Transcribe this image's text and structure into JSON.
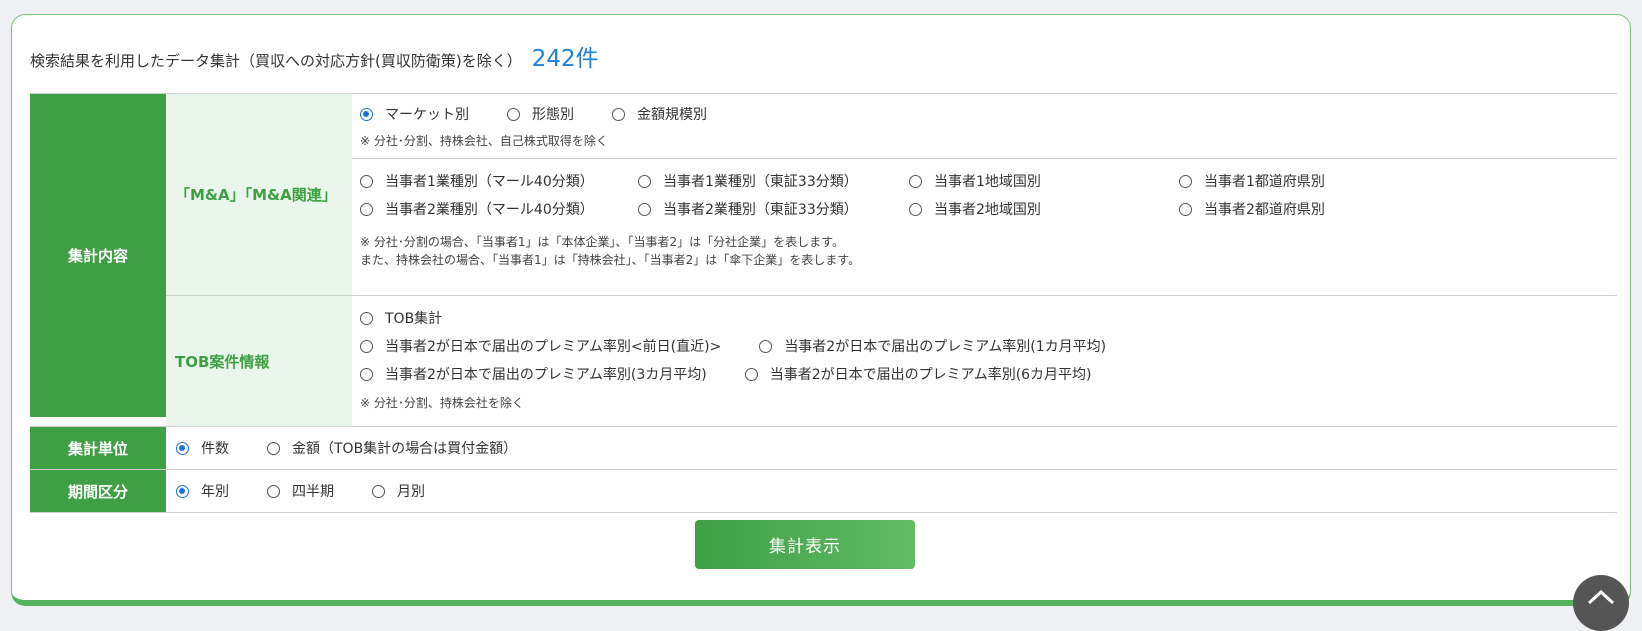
{
  "header": {
    "title": "検索結果を利用したデータ集計（買収への対応方針(買収防衛策)を除く）",
    "count": "242件"
  },
  "sections": {
    "aggregate_content_label": "集計内容",
    "ma": {
      "label": "「M&A」「M&A関連」",
      "market_options": [
        "マーケット別",
        "形態別",
        "金額規模別"
      ],
      "market_note": "※ 分社･分割、持株会社、自己株式取得を除く",
      "party_row1": [
        "当事者1業種別（マール40分類）",
        "当事者1業種別（東証33分類）",
        "当事者1地域国別",
        "当事者1都道府県別"
      ],
      "party_row2": [
        "当事者2業種別（マール40分類）",
        "当事者2業種別（東証33分類）",
        "当事者2地域国別",
        "当事者2都道府県別"
      ],
      "party_note1": "※ 分社･分割の場合、「当事者1」は「本体企業」、「当事者2」は「分社企業」を表します。",
      "party_note2": "また、持株会社の場合、「当事者1」は「持株会社」、「当事者2」は「傘下企業」を表します。"
    },
    "tob": {
      "label": "TOB案件情報",
      "opt_tob": "TOB集計",
      "opt_prem_prev": "当事者2が日本で届出のプレミアム率別<前日(直近)>",
      "opt_prem_1m": "当事者2が日本で届出のプレミアム率別(1カ月平均)",
      "opt_prem_3m": "当事者2が日本で届出のプレミアム率別(3カ月平均)",
      "opt_prem_6m": "当事者2が日本で届出のプレミアム率別(6カ月平均)",
      "note": "※ 分社･分割、持株会社を除く"
    },
    "unit": {
      "label": "集計単位",
      "options": [
        "件数",
        "金額（TOB集計の場合は買付金額）"
      ]
    },
    "period": {
      "label": "期間区分",
      "options": [
        "年別",
        "四半期",
        "月別"
      ]
    }
  },
  "submit_label": "集計表示",
  "colors": {
    "accent_green": "#3f9f45",
    "light_green": "#eaf6eb",
    "count_blue": "#1e7fd8",
    "radio_blue": "#1a73d9"
  }
}
